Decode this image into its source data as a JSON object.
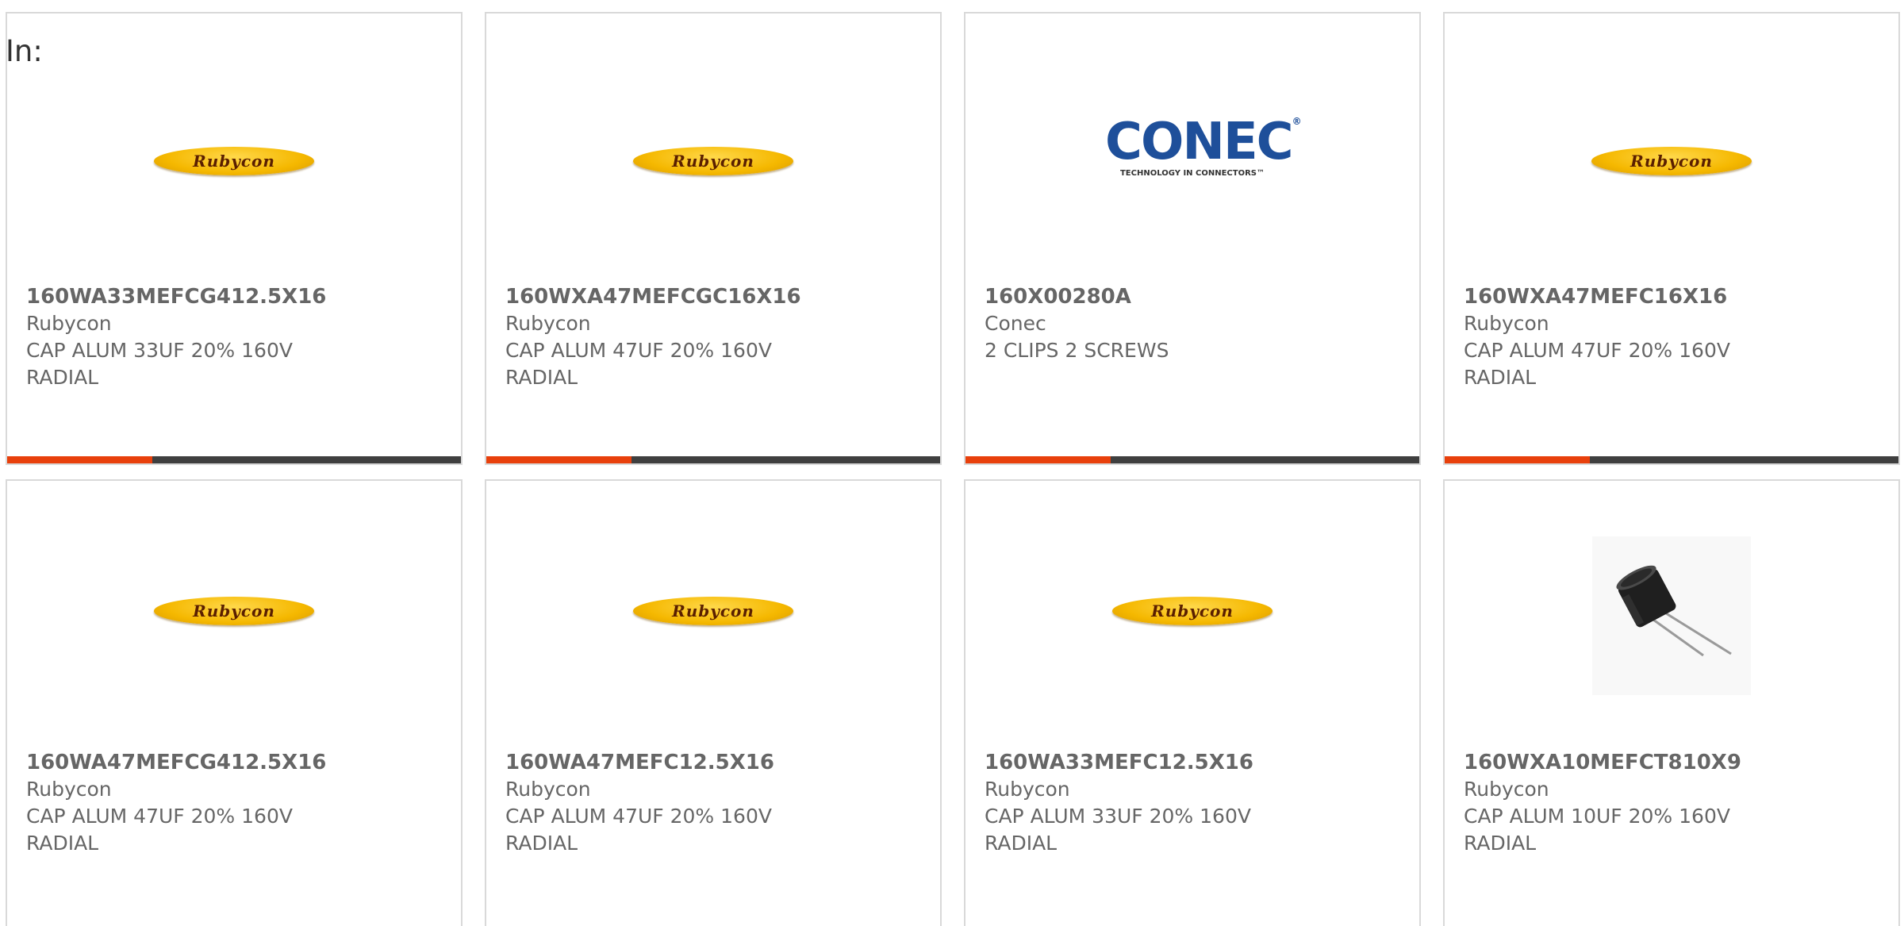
{
  "filter": {
    "label": "In:"
  },
  "colors": {
    "accent": "#e8400c",
    "track": "#3f3f3f",
    "rubycon_yellow": "#f5b800",
    "conec_blue": "#1e4f9a"
  },
  "cards": [
    {
      "image": "rubycon-logo",
      "logo_text": "Rubycon",
      "part_number": "160WA33MEFCG412.5X16",
      "manufacturer": "Rubycon",
      "description": "CAP ALUM 33UF 20% 160V RADIAL",
      "progress": 0.32
    },
    {
      "image": "rubycon-logo",
      "logo_text": "Rubycon",
      "part_number": "160WXA47MEFCGC16X16",
      "manufacturer": "Rubycon",
      "description": "CAP ALUM 47UF 20% 160V RADIAL",
      "progress": 0.32
    },
    {
      "image": "conec-logo",
      "logo_text": "CONEC",
      "logo_tagline": "TECHNOLOGY IN CONNECTORS™",
      "part_number": "160X00280A",
      "manufacturer": "Conec",
      "description": "2 CLIPS 2 SCREWS",
      "progress": 0.32
    },
    {
      "image": "rubycon-logo",
      "logo_text": "Rubycon",
      "part_number": "160WXA47MEFC16X16",
      "manufacturer": "Rubycon",
      "description": "CAP ALUM 47UF 20% 160V RADIAL",
      "progress": 0.32
    },
    {
      "image": "rubycon-logo",
      "logo_text": "Rubycon",
      "part_number": "160WA47MEFCG412.5X16",
      "manufacturer": "Rubycon",
      "description": "CAP ALUM 47UF 20% 160V RADIAL"
    },
    {
      "image": "rubycon-logo",
      "logo_text": "Rubycon",
      "part_number": "160WA47MEFC12.5X16",
      "manufacturer": "Rubycon",
      "description": "CAP ALUM 47UF 20% 160V RADIAL"
    },
    {
      "image": "rubycon-logo",
      "logo_text": "Rubycon",
      "part_number": "160WA33MEFC12.5X16",
      "manufacturer": "Rubycon",
      "description": "CAP ALUM 33UF 20% 160V RADIAL"
    },
    {
      "image": "capacitor-photo",
      "part_number": "160WXA10MEFCT810X9",
      "manufacturer": "Rubycon",
      "description": "CAP ALUM 10UF 20% 160V RADIAL"
    }
  ]
}
